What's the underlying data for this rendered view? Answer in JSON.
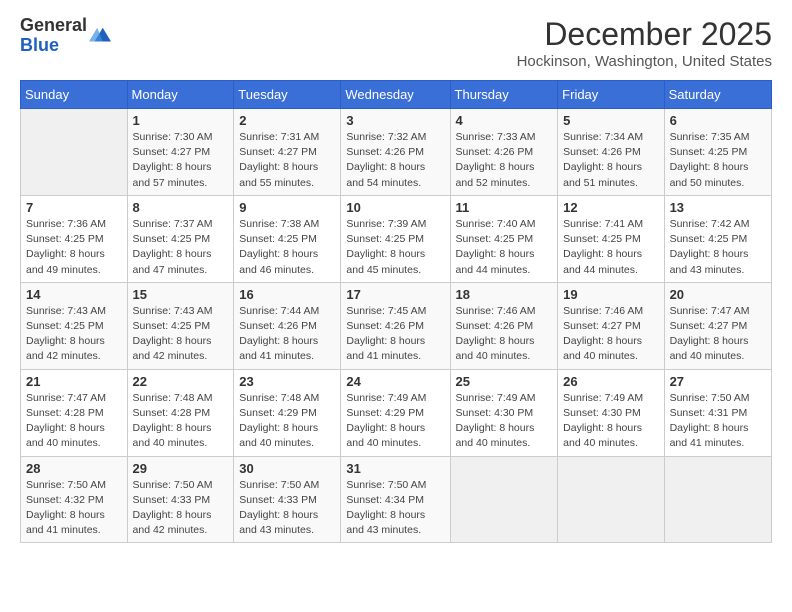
{
  "logo": {
    "general": "General",
    "blue": "Blue"
  },
  "header": {
    "title": "December 2025",
    "subtitle": "Hockinson, Washington, United States"
  },
  "weekdays": [
    "Sunday",
    "Monday",
    "Tuesday",
    "Wednesday",
    "Thursday",
    "Friday",
    "Saturday"
  ],
  "weeks": [
    [
      {
        "day": "",
        "info": ""
      },
      {
        "day": "1",
        "info": "Sunrise: 7:30 AM\nSunset: 4:27 PM\nDaylight: 8 hours\nand 57 minutes."
      },
      {
        "day": "2",
        "info": "Sunrise: 7:31 AM\nSunset: 4:27 PM\nDaylight: 8 hours\nand 55 minutes."
      },
      {
        "day": "3",
        "info": "Sunrise: 7:32 AM\nSunset: 4:26 PM\nDaylight: 8 hours\nand 54 minutes."
      },
      {
        "day": "4",
        "info": "Sunrise: 7:33 AM\nSunset: 4:26 PM\nDaylight: 8 hours\nand 52 minutes."
      },
      {
        "day": "5",
        "info": "Sunrise: 7:34 AM\nSunset: 4:26 PM\nDaylight: 8 hours\nand 51 minutes."
      },
      {
        "day": "6",
        "info": "Sunrise: 7:35 AM\nSunset: 4:25 PM\nDaylight: 8 hours\nand 50 minutes."
      }
    ],
    [
      {
        "day": "7",
        "info": "Sunrise: 7:36 AM\nSunset: 4:25 PM\nDaylight: 8 hours\nand 49 minutes."
      },
      {
        "day": "8",
        "info": "Sunrise: 7:37 AM\nSunset: 4:25 PM\nDaylight: 8 hours\nand 47 minutes."
      },
      {
        "day": "9",
        "info": "Sunrise: 7:38 AM\nSunset: 4:25 PM\nDaylight: 8 hours\nand 46 minutes."
      },
      {
        "day": "10",
        "info": "Sunrise: 7:39 AM\nSunset: 4:25 PM\nDaylight: 8 hours\nand 45 minutes."
      },
      {
        "day": "11",
        "info": "Sunrise: 7:40 AM\nSunset: 4:25 PM\nDaylight: 8 hours\nand 44 minutes."
      },
      {
        "day": "12",
        "info": "Sunrise: 7:41 AM\nSunset: 4:25 PM\nDaylight: 8 hours\nand 44 minutes."
      },
      {
        "day": "13",
        "info": "Sunrise: 7:42 AM\nSunset: 4:25 PM\nDaylight: 8 hours\nand 43 minutes."
      }
    ],
    [
      {
        "day": "14",
        "info": "Sunrise: 7:43 AM\nSunset: 4:25 PM\nDaylight: 8 hours\nand 42 minutes."
      },
      {
        "day": "15",
        "info": "Sunrise: 7:43 AM\nSunset: 4:25 PM\nDaylight: 8 hours\nand 42 minutes."
      },
      {
        "day": "16",
        "info": "Sunrise: 7:44 AM\nSunset: 4:26 PM\nDaylight: 8 hours\nand 41 minutes."
      },
      {
        "day": "17",
        "info": "Sunrise: 7:45 AM\nSunset: 4:26 PM\nDaylight: 8 hours\nand 41 minutes."
      },
      {
        "day": "18",
        "info": "Sunrise: 7:46 AM\nSunset: 4:26 PM\nDaylight: 8 hours\nand 40 minutes."
      },
      {
        "day": "19",
        "info": "Sunrise: 7:46 AM\nSunset: 4:27 PM\nDaylight: 8 hours\nand 40 minutes."
      },
      {
        "day": "20",
        "info": "Sunrise: 7:47 AM\nSunset: 4:27 PM\nDaylight: 8 hours\nand 40 minutes."
      }
    ],
    [
      {
        "day": "21",
        "info": "Sunrise: 7:47 AM\nSunset: 4:28 PM\nDaylight: 8 hours\nand 40 minutes."
      },
      {
        "day": "22",
        "info": "Sunrise: 7:48 AM\nSunset: 4:28 PM\nDaylight: 8 hours\nand 40 minutes."
      },
      {
        "day": "23",
        "info": "Sunrise: 7:48 AM\nSunset: 4:29 PM\nDaylight: 8 hours\nand 40 minutes."
      },
      {
        "day": "24",
        "info": "Sunrise: 7:49 AM\nSunset: 4:29 PM\nDaylight: 8 hours\nand 40 minutes."
      },
      {
        "day": "25",
        "info": "Sunrise: 7:49 AM\nSunset: 4:30 PM\nDaylight: 8 hours\nand 40 minutes."
      },
      {
        "day": "26",
        "info": "Sunrise: 7:49 AM\nSunset: 4:30 PM\nDaylight: 8 hours\nand 40 minutes."
      },
      {
        "day": "27",
        "info": "Sunrise: 7:50 AM\nSunset: 4:31 PM\nDaylight: 8 hours\nand 41 minutes."
      }
    ],
    [
      {
        "day": "28",
        "info": "Sunrise: 7:50 AM\nSunset: 4:32 PM\nDaylight: 8 hours\nand 41 minutes."
      },
      {
        "day": "29",
        "info": "Sunrise: 7:50 AM\nSunset: 4:33 PM\nDaylight: 8 hours\nand 42 minutes."
      },
      {
        "day": "30",
        "info": "Sunrise: 7:50 AM\nSunset: 4:33 PM\nDaylight: 8 hours\nand 43 minutes."
      },
      {
        "day": "31",
        "info": "Sunrise: 7:50 AM\nSunset: 4:34 PM\nDaylight: 8 hours\nand 43 minutes."
      },
      {
        "day": "",
        "info": ""
      },
      {
        "day": "",
        "info": ""
      },
      {
        "day": "",
        "info": ""
      }
    ]
  ]
}
